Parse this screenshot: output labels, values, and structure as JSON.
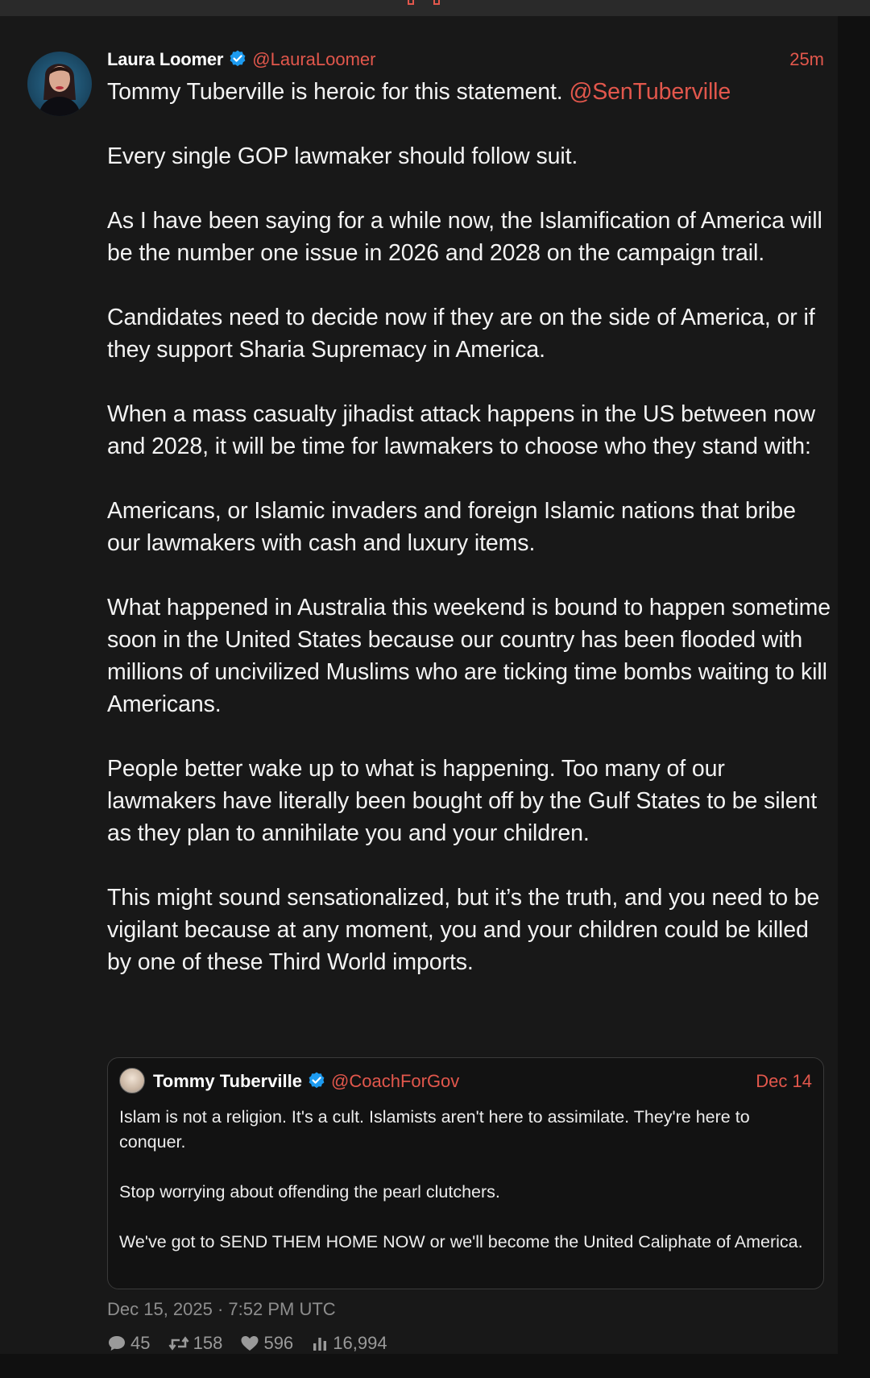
{
  "post": {
    "author_name": "Laura Loomer",
    "author_handle": "@LauraLoomer",
    "time_ago": "25m",
    "text_lead": "Tommy Tuberville is heroic for this statement.",
    "mention": "@SenTuberville",
    "paragraphs": [
      "Every single GOP lawmaker should follow suit.",
      "As I have been saying for a while now, the Islamification of America will be the number one issue in 2026 and 2028 on the campaign trail.",
      "Candidates need to decide now if they are on the side of America, or if they support Sharia Supremacy in America.",
      "When a mass casualty jihadist attack happens in the US between now and 2028, it will be time for lawmakers to choose who they stand with:",
      "Americans, or Islamic invaders and foreign Islamic nations that bribe our lawmakers with cash and luxury items.",
      "What happened in Australia this weekend is bound to happen sometime soon in the United States because our country has been flooded with millions of uncivilized Muslims who are ticking time bombs waiting to kill Americans.",
      "People better wake up to what is happening. Too many of our lawmakers have literally been bought off by the Gulf States to be silent as they plan to annihilate you and your children.",
      "This might sound sensationalized, but it’s the truth, and you need to be vigilant because at any moment, you and your children could be killed by one of these Third World imports."
    ],
    "timestamp": "Dec 15, 2025 · 7:52 PM UTC"
  },
  "quote": {
    "author_name": "Tommy Tuberville",
    "author_handle": "@CoachForGov",
    "date": "Dec 14",
    "paragraphs": [
      "Islam is not a religion. It's a cult. Islamists aren't here to assimilate. They're here to conquer.",
      "Stop worrying about offending the pearl clutchers.",
      "We've got to SEND THEM HOME NOW or we'll become the United Caliphate of America."
    ]
  },
  "stats": {
    "replies": "45",
    "retweets": "158",
    "likes": "596",
    "views": "16,994"
  },
  "icons": {
    "verified": "verified-badge-icon",
    "reply": "comment-bubble-icon",
    "retweet": "retweet-icon",
    "like": "heart-icon",
    "views": "bar-chart-icon"
  },
  "colors": {
    "accent": "#e2574c",
    "verified": "#1d9bf0",
    "background": "#181818",
    "muted": "#8e8e8e"
  }
}
